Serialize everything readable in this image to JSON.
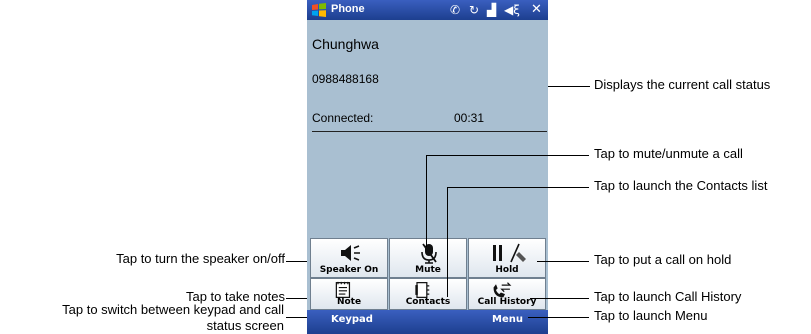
{
  "window": {
    "title": "Phone"
  },
  "call": {
    "contact_name": "Chunghwa",
    "number": "0988488168",
    "status_label": "Connected:",
    "duration": "00:31"
  },
  "buttons": {
    "speaker": "Speaker On",
    "mute": "Mute",
    "hold": "Hold",
    "note": "Note",
    "contacts": "Contacts",
    "call_history": "Call History"
  },
  "softkeys": {
    "left": "Keypad",
    "right": "Menu"
  },
  "annotations": {
    "status": "Displays the current call status",
    "mute": "Tap to mute/unmute a call",
    "contacts": "Tap to launch the Contacts list",
    "hold": "Tap to put a call on hold",
    "call_history": "Tap to launch Call History",
    "menu": "Tap to launch Menu",
    "speaker": "Tap to turn the speaker on/off",
    "note": "Tap to take notes",
    "keypad_line1": "Tap to switch between keypad and call",
    "keypad_line2": "status screen"
  }
}
